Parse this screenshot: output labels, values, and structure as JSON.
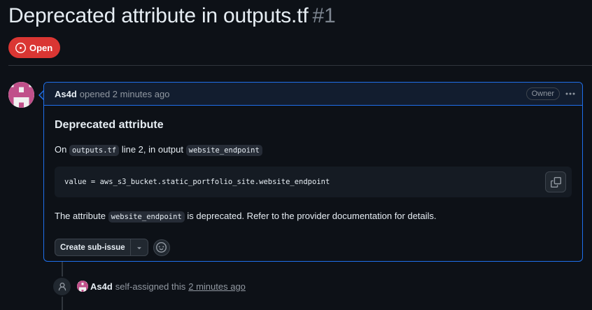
{
  "issue": {
    "title": "Deprecated attribute in outputs.tf",
    "number": "#1",
    "state": "Open"
  },
  "comment": {
    "author": "As4d",
    "meta": "opened 2 minutes ago",
    "role_badge": "Owner",
    "heading": "Deprecated attribute",
    "line1": {
      "prefix": "On",
      "file": "outputs.tf",
      "middle": "line 2, in output",
      "output_name": "website_endpoint"
    },
    "code": "value = aws_s3_bucket.static_portfolio_site.website_endpoint",
    "line2": {
      "prefix": "The attribute",
      "attr": "website_endpoint",
      "suffix": "is deprecated. Refer to the provider documentation for details."
    },
    "create_subissue_label": "Create sub-issue"
  },
  "timeline_event": {
    "author": "As4d",
    "action": "self-assigned this",
    "time": "2 minutes ago"
  },
  "colors": {
    "background": "#0d1117",
    "open_badge": "#da3633",
    "accent_border": "#1f6feb",
    "avatar_pink": "#c0508a"
  },
  "icons": [
    "issue-opened-icon",
    "kebab-horizontal-icon",
    "copy-icon",
    "triangle-down-icon",
    "smiley-icon",
    "person-icon"
  ]
}
